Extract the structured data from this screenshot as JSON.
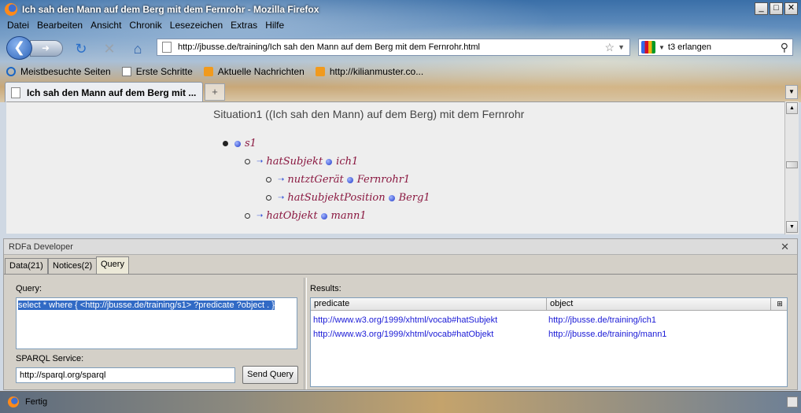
{
  "window": {
    "title": "Ich sah den Mann auf dem Berg mit dem Fernrohr - Mozilla Firefox",
    "minimize": "_",
    "maximize": "□",
    "close": "✕"
  },
  "menu": [
    "Datei",
    "Bearbeiten",
    "Ansicht",
    "Chronik",
    "Lesezeichen",
    "Extras",
    "Hilfe"
  ],
  "nav": {
    "url": "http://jbusse.de/training/Ich sah den Mann auf dem Berg mit dem Fernrohr.html",
    "search_value": "t3 erlangen",
    "icons": [
      "back-icon",
      "forward-icon",
      "reload-icon",
      "stop-icon",
      "home-icon",
      "bookmark-star-icon",
      "search-go-icon"
    ]
  },
  "bookmarks": [
    {
      "label": "Meistbesuchte Seiten",
      "icon": "smart-folder-icon"
    },
    {
      "label": "Erste Schritte",
      "icon": "page-icon"
    },
    {
      "label": "Aktuelle Nachrichten",
      "icon": "rss-icon"
    },
    {
      "label": "http://kilianmuster.co...",
      "icon": "rss-icon"
    }
  ],
  "tabs": {
    "active_label": "Ich sah den Mann auf dem Berg mit ...",
    "new_tab": "+"
  },
  "content": {
    "heading": "Situation1 ((Ich sah den Mann) auf dem Berg) mit dem Fernrohr",
    "tree": {
      "root": "s1",
      "n1_pred": "hatSubjekt",
      "n1_obj": "ich1",
      "n2_pred": "nutztGerät",
      "n2_obj": "Fernrohr1",
      "n3_pred": "hatSubjektPosition",
      "n3_obj": "Berg1",
      "n4_pred": "hatObjekt",
      "n4_obj": "mann1"
    }
  },
  "panel": {
    "title": "RDFa Developer",
    "tabs": [
      "Data(21)",
      "Notices(2)",
      "Query"
    ],
    "active_tab": "Query",
    "query_label": "Query:",
    "query_text": "select * where { <http://jbusse.de/training/s1> ?predicate ?object . }",
    "service_label": "SPARQL Service:",
    "service_value": "http://sparql.org/sparql",
    "send_label": "Send Query",
    "results_label": "Results:",
    "columns": [
      "predicate",
      "object"
    ],
    "rows": [
      [
        "http://www.w3.org/1999/xhtml/vocab#hatSubjekt",
        "http://jbusse.de/training/ich1"
      ],
      [
        "http://www.w3.org/1999/xhtml/vocab#hatObjekt",
        "http://jbusse.de/training/mann1"
      ]
    ]
  },
  "status": {
    "text": "Fertig"
  }
}
